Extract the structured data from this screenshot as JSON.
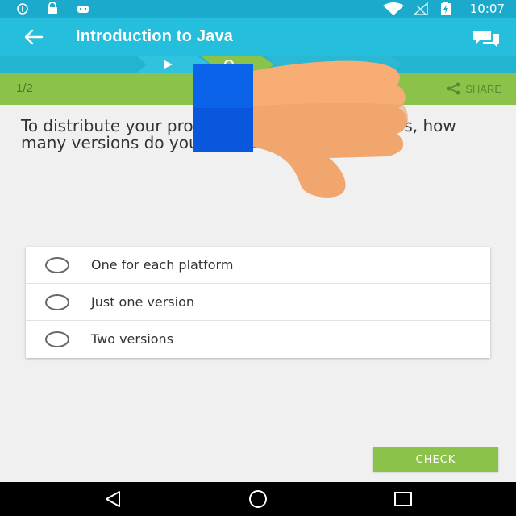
{
  "status_bar": {
    "time": "10:07",
    "icons": [
      "info-icon",
      "lock-icon",
      "android-icon",
      "wifi-icon",
      "signal-icon",
      "battery-icon"
    ]
  },
  "app_bar": {
    "title": "Introduction to Java",
    "back_icon": "arrow-left-icon",
    "discuss_icon": "comments-icon"
  },
  "info_bar": {
    "lesson_count": "1/2",
    "share_label": "SHARE",
    "share_icon": "share-icon"
  },
  "question": {
    "text": "To distribute your program to different platforms, how many versions do you need to create?"
  },
  "answers": [
    {
      "label": "One for each platform",
      "selected": false
    },
    {
      "label": "Just one version",
      "selected": false
    },
    {
      "label": "Two versions",
      "selected": false
    }
  ],
  "check_button": {
    "label": "CHECK"
  },
  "overlay": {
    "icon": "thumbs-down-icon"
  },
  "colors": {
    "status_bar": "#1baacb",
    "app_bar": "#25bedc",
    "accent_green": "#8bc34a",
    "overlay_blue": "#0a63e8",
    "overlay_skin": "#f7ad74"
  }
}
